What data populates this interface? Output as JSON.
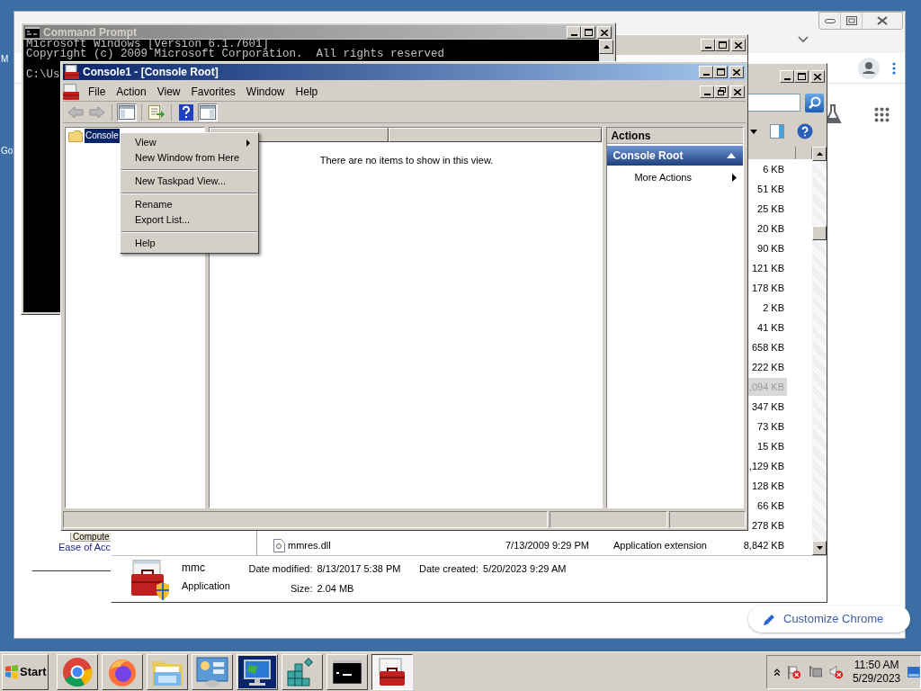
{
  "desktop": {
    "labels": [
      "M",
      "Go"
    ]
  },
  "chrome": {
    "customize_button": "Customize Chrome"
  },
  "back_window": {
    "tab": "Compute",
    "link": "Ease of Acc"
  },
  "explorer": {
    "rows": [
      {
        "size": "6 KB",
        "selected": false
      },
      {
        "size": "51 KB",
        "selected": false
      },
      {
        "size": "25 KB",
        "selected": false
      },
      {
        "size": "20 KB",
        "selected": false
      },
      {
        "size": "90 KB",
        "selected": false
      },
      {
        "size": "121 KB",
        "selected": false
      },
      {
        "size": "178 KB",
        "selected": false
      },
      {
        "size": "2 KB",
        "selected": false
      },
      {
        "size": "41 KB",
        "selected": false
      },
      {
        "size": "658 KB",
        "selected": false
      },
      {
        "size": "222 KB",
        "selected": false
      },
      {
        "size": ",094 KB",
        "selected": true
      },
      {
        "size": "347 KB",
        "selected": false
      },
      {
        "size": "73 KB",
        "selected": false
      },
      {
        "size": "15 KB",
        "selected": false
      },
      {
        "size": ",129 KB",
        "selected": false
      },
      {
        "size": "128 KB",
        "selected": false
      },
      {
        "size": "66 KB",
        "selected": false
      },
      {
        "size": "278 KB",
        "selected": false
      }
    ],
    "last_row": {
      "name": "mmres.dll",
      "date": "7/13/2009 9:29 PM",
      "type": "Application extension",
      "size": "8,842 KB"
    },
    "details": {
      "name": "mmc",
      "type": "Application",
      "modified_label": "Date modified:",
      "modified": "8/13/2017 5:38 PM",
      "size_label": "Size:",
      "size": "2.04 MB",
      "created_label": "Date created:",
      "created": "5/20/2023 9:29 AM"
    }
  },
  "cmd": {
    "title": "Command Prompt",
    "active": false,
    "header_lines": [
      "Microsoft Windows [Version 6.1.7601]",
      "Copyright (c) 2009 Microsoft Corporation.  All rights reserved"
    ],
    "prompt": "C:\\Us"
  },
  "mmc": {
    "title": "Console1 - [Console Root]",
    "active": true,
    "menu": [
      "File",
      "Action",
      "View",
      "Favorites",
      "Window",
      "Help"
    ],
    "tree": [
      {
        "label": "Console",
        "selected": true
      }
    ],
    "empty_message": "There are no items to show in this view.",
    "actions": {
      "header": "Actions",
      "section": {
        "label": "Console Root",
        "expanded": true
      },
      "items": [
        {
          "label": "More Actions",
          "submenu": true
        }
      ]
    }
  },
  "context_menu": {
    "groups": [
      [
        {
          "label": "View",
          "submenu": true
        },
        {
          "label": "New Window from Here",
          "submenu": false
        }
      ],
      [
        {
          "label": "New Taskpad View...",
          "submenu": false
        }
      ],
      [
        {
          "label": "Rename",
          "submenu": false
        },
        {
          "label": "Export List...",
          "submenu": false
        }
      ],
      [
        {
          "label": "Help",
          "submenu": false
        }
      ]
    ]
  },
  "taskbar": {
    "start": "Start",
    "apps": [
      {
        "kind": "chrome",
        "active": false
      },
      {
        "kind": "firefox",
        "active": false
      },
      {
        "kind": "explorer",
        "active": false
      },
      {
        "kind": "control-panel",
        "active": false
      },
      {
        "kind": "monitor",
        "active": false
      },
      {
        "kind": "registry",
        "active": false
      },
      {
        "kind": "cmd",
        "active": false
      },
      {
        "kind": "mmc",
        "active": true
      }
    ],
    "clock": {
      "time": "11:50 AM",
      "date": "5/29/2023"
    }
  }
}
